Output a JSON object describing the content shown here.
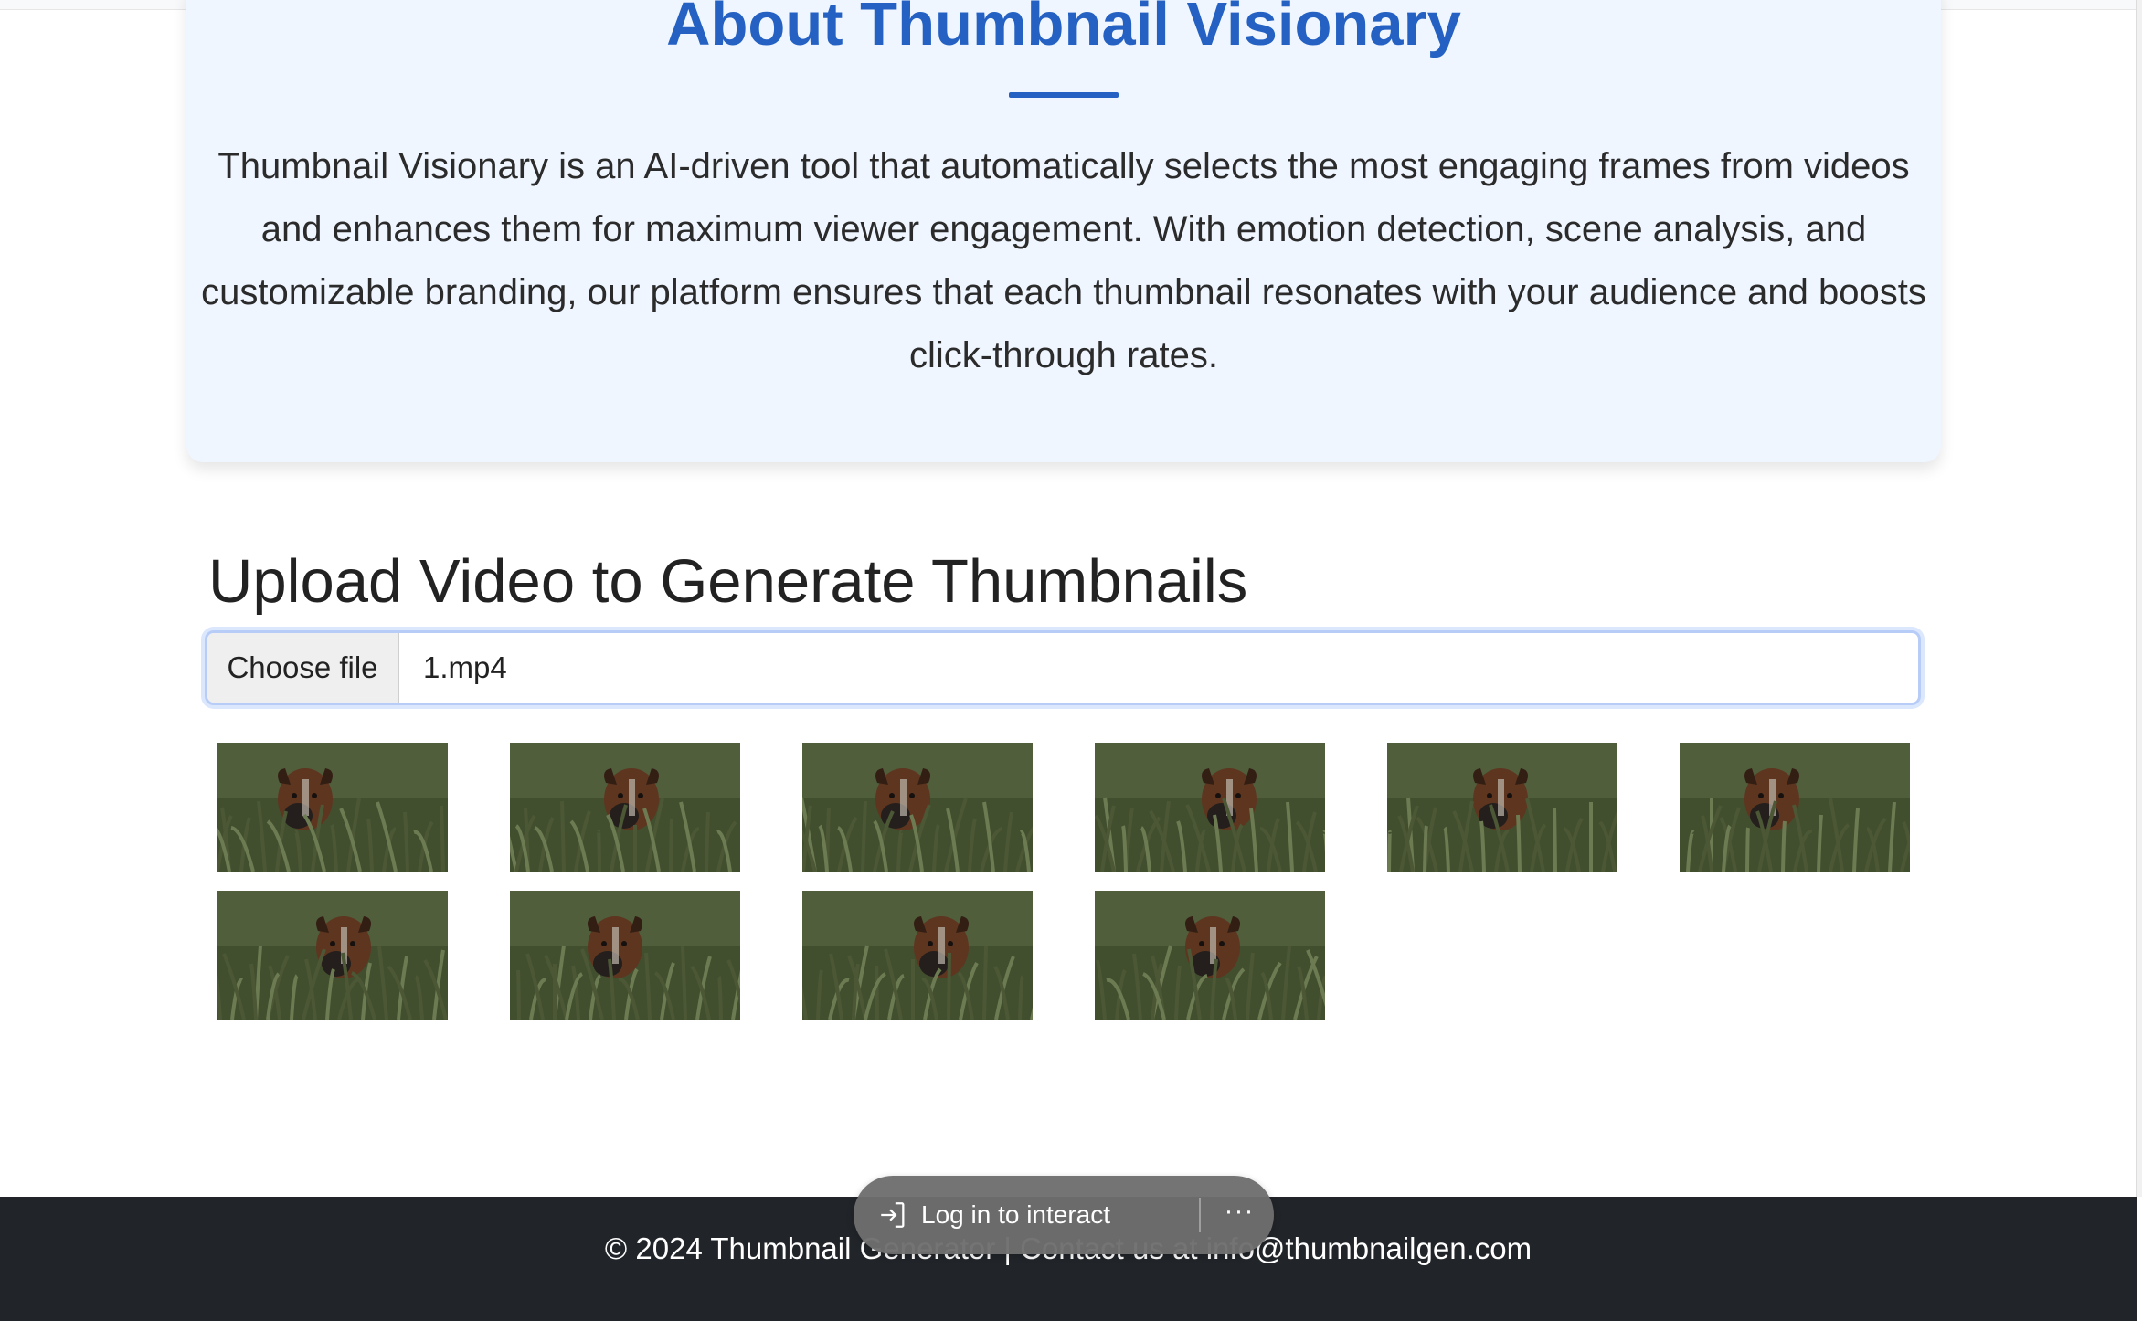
{
  "about": {
    "title": "About Thumbnail Visionary",
    "description": "Thumbnail Visionary is an AI-driven tool that automatically selects the most engaging frames from videos and enhances them for maximum viewer engagement. With emotion detection, scene analysis, and customizable branding, our platform ensures that each thumbnail resonates with your audience and boosts click-through rates."
  },
  "upload": {
    "title": "Upload Video to Generate Thumbnails",
    "choose_label": "Choose file",
    "file_name": "1.mp4"
  },
  "thumbnails": [
    {
      "name": "thumbnail-1",
      "icon": "dog-in-grass-image"
    },
    {
      "name": "thumbnail-2",
      "icon": "dog-in-grass-image"
    },
    {
      "name": "thumbnail-3",
      "icon": "dog-in-grass-image"
    },
    {
      "name": "thumbnail-4",
      "icon": "dog-in-grass-image"
    },
    {
      "name": "thumbnail-5",
      "icon": "dog-in-grass-image"
    },
    {
      "name": "thumbnail-6",
      "icon": "dog-in-grass-image"
    },
    {
      "name": "thumbnail-7",
      "icon": "dog-in-grass-image"
    },
    {
      "name": "thumbnail-8",
      "icon": "dog-in-grass-image"
    },
    {
      "name": "thumbnail-9",
      "icon": "dog-in-grass-image"
    },
    {
      "name": "thumbnail-10",
      "icon": "dog-in-grass-image"
    }
  ],
  "footer": {
    "text": "© 2024 Thumbnail Generator | Contact us at info@thumbnailgen.com"
  },
  "overlay": {
    "login_label": "Log in to interact",
    "more_label": "···"
  },
  "colors": {
    "accent": "#2461c2",
    "card_bg": "#eff6ff",
    "footer_bg": "#212529"
  }
}
